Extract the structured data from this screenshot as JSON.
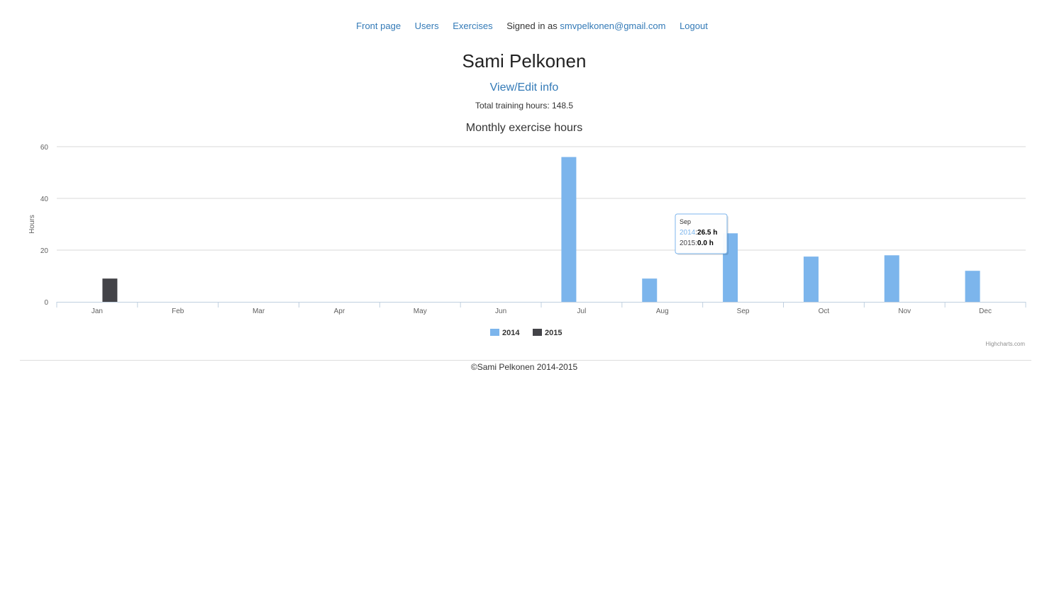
{
  "nav": {
    "front_page": "Front page",
    "users": "Users",
    "exercises": "Exercises",
    "signed_in_prefix": "Signed in as ",
    "user_email": "smvpelkonen@gmail.com",
    "logout": "Logout"
  },
  "profile": {
    "name": "Sami Pelkonen",
    "edit_link": "View/Edit info",
    "total_label": "Total training hours: 148.5"
  },
  "chart_data": {
    "type": "bar",
    "title": "Monthly exercise hours",
    "ylabel": "Hours",
    "xlabel": "",
    "categories": [
      "Jan",
      "Feb",
      "Mar",
      "Apr",
      "May",
      "Jun",
      "Jul",
      "Aug",
      "Sep",
      "Oct",
      "Nov",
      "Dec"
    ],
    "ylim": [
      0,
      60
    ],
    "yticks": [
      0,
      20,
      40,
      60
    ],
    "grid": true,
    "legend": "bottom-center",
    "series": [
      {
        "name": "2014",
        "color": "#7cb5ec",
        "values": [
          0,
          0,
          0,
          0,
          0,
          0,
          56,
          9,
          26.5,
          17.5,
          18,
          12
        ]
      },
      {
        "name": "2015",
        "color": "#434348",
        "values": [
          9,
          0,
          0,
          0,
          0,
          0,
          0,
          0,
          0,
          0,
          0,
          0
        ]
      }
    ],
    "tooltip": {
      "category": "Sep",
      "rows": [
        {
          "series": "2014",
          "sep": ":",
          "value": "26.5 h"
        },
        {
          "series": "2015",
          "sep": ":",
          "value": "0.0 h"
        }
      ]
    },
    "credits": "Highcharts.com"
  },
  "footer": {
    "text": "©Sami Pelkonen 2014-2015"
  }
}
